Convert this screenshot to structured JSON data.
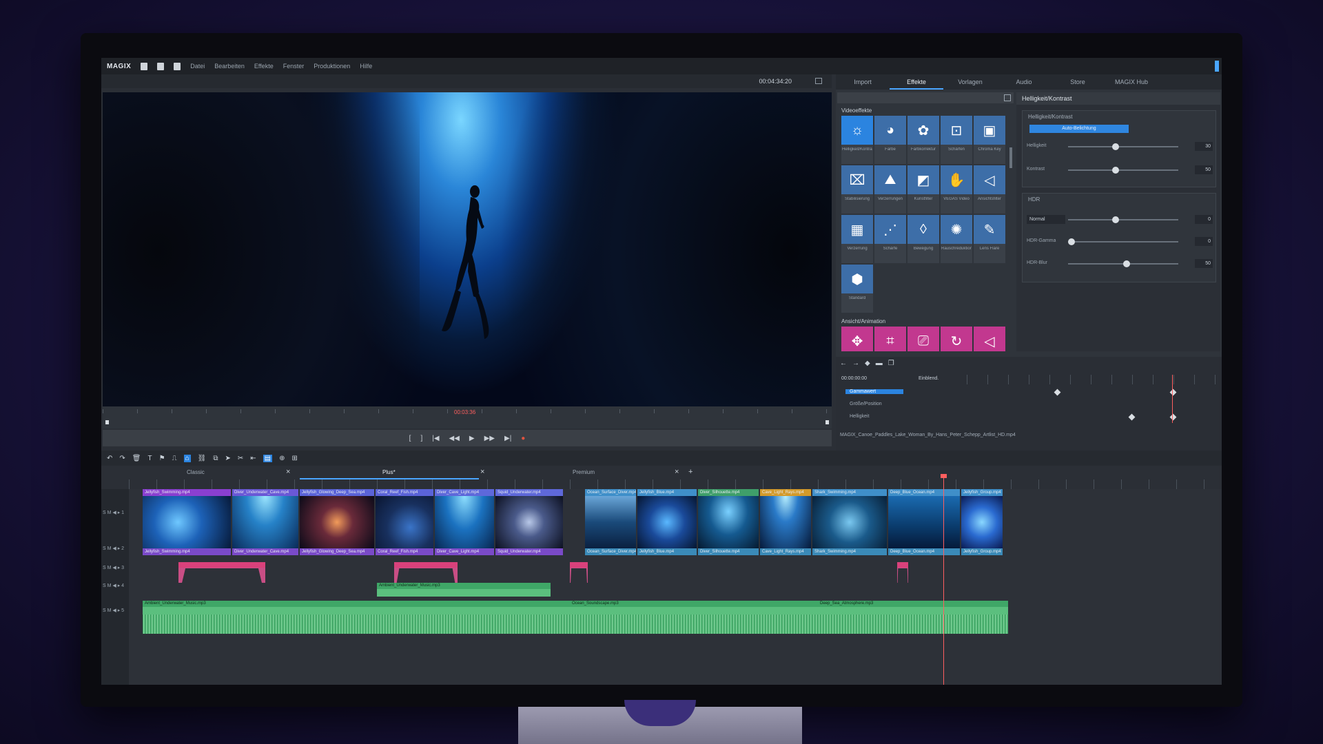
{
  "menubar": {
    "logo": "MAGIX",
    "items": [
      "Datei",
      "Bearbeiten",
      "Effekte",
      "Fenster",
      "Produktionen",
      "Hilfe"
    ]
  },
  "preview": {
    "timecode": "00:04:34:20",
    "position": "00:03:36"
  },
  "right_panel": {
    "tabs": [
      "Import",
      "Effekte",
      "Vorlagen",
      "Audio",
      "Store",
      "MAGIX Hub"
    ],
    "active_tab": "Effekte",
    "category_video": "Videoeffekte",
    "category_anim": "Ansicht/Animation",
    "effects_row1": [
      "Helligkeit/Kontrast",
      "Farbe",
      "Farbkorrektur",
      "Schärfen",
      "Chroma Key"
    ],
    "effects_row2": [
      "Stabilisierung",
      "Verzerrungen",
      "Kunstfilter",
      "VEGAS Video",
      "Ansichtsfilter"
    ],
    "effects_row3": [
      "Verzerrung",
      "Schärfe",
      "Bewegung",
      "Rauschreduktion",
      "Lens Flare"
    ],
    "effects_row4": [
      "Standard"
    ],
    "props_title": "Helligkeit/Kontrast",
    "grp1_title": "Helligkeit/Kontrast",
    "auto_button": "Auto-Belichtung",
    "brightness_label": "Helligkeit",
    "brightness_value": "30",
    "brightness_level": 0.4,
    "contrast_label": "Kontrast",
    "contrast_value": "50",
    "contrast_level": 0.4,
    "grp2_title": "HDR",
    "hdr_mode": "Normal",
    "hdr_mode_value": "0",
    "hdr_gamma_label": "HDR-Gamma",
    "hdr_gamma_value": "0",
    "hdr_blur_label": "HDR-Blur",
    "hdr_blur_value": "50"
  },
  "keyframes": {
    "time": "00:00:00:00",
    "label": "Einblend.",
    "rows": [
      "Gammawert",
      "Größe/Position",
      "Helligkeit"
    ],
    "file": "MAGIX_Canoe_Paddles_Lake_Woman_By_Hans_Peter_Schepp_Artlist_HD.mp4"
  },
  "project_tabs": [
    "Classic",
    "Plus*",
    "Premium"
  ],
  "video_clips": [
    "Jellyfish_Swimming.mp4",
    "Diver_Underwater_Cave.mp4",
    "Jellyfish_Glowing_Deep_Sea.mp4",
    "Coral_Reef_Fish.mp4",
    "Diver_Cave_Light.mp4",
    "Squid_Underwater.mp4",
    "Ocean_Surface_Diver.mp4",
    "Jellyfish_Blue.mp4",
    "Diver_Silhouette.mp4",
    "Cave_Light_Rays.mp4",
    "Shark_Swimming.mp4",
    "Deep_Blue_Ocean.mp4",
    "Jellyfish_Group.mp4"
  ],
  "audio_clips": [
    "Ambient_Underwater_Music.mp3",
    "Ocean_Soundscape.mp3",
    "Deep_Sea_Atmosphere.mp3"
  ],
  "colors": {
    "accent": "#4aa6ff",
    "effect_blue": "#3d6ea8",
    "animation_pink": "#c2388f",
    "audio_green": "#5bbf7e",
    "playhead": "#ff5f5f"
  }
}
